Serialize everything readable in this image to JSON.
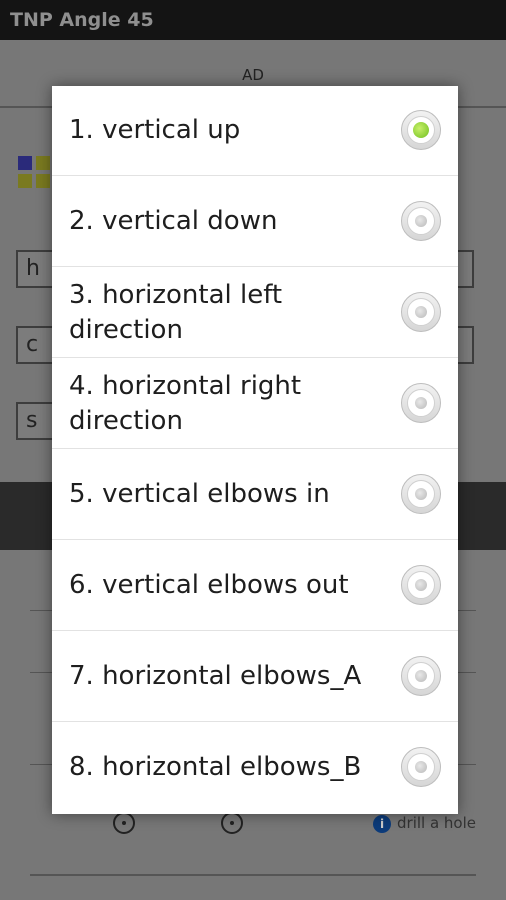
{
  "app": {
    "title": "TNP Angle 45",
    "ad_label": "AD",
    "field_letters": [
      "h",
      "c",
      "s"
    ],
    "hole_label": "drill a hole",
    "info_icon": "info-icon"
  },
  "dialog": {
    "options": [
      {
        "label": "1. vertical up",
        "selected": true
      },
      {
        "label": "2. vertical down",
        "selected": false
      },
      {
        "label": "3. horizontal left direction",
        "selected": false
      },
      {
        "label": "4. horizontal right direction",
        "selected": false
      },
      {
        "label": "5. vertical elbows in",
        "selected": false
      },
      {
        "label": "6. vertical elbows out",
        "selected": false
      },
      {
        "label": "7. horizontal elbows_A",
        "selected": false
      },
      {
        "label": "8. horizontal elbows_B",
        "selected": false
      }
    ],
    "accent_color": "#6fbf1f"
  }
}
